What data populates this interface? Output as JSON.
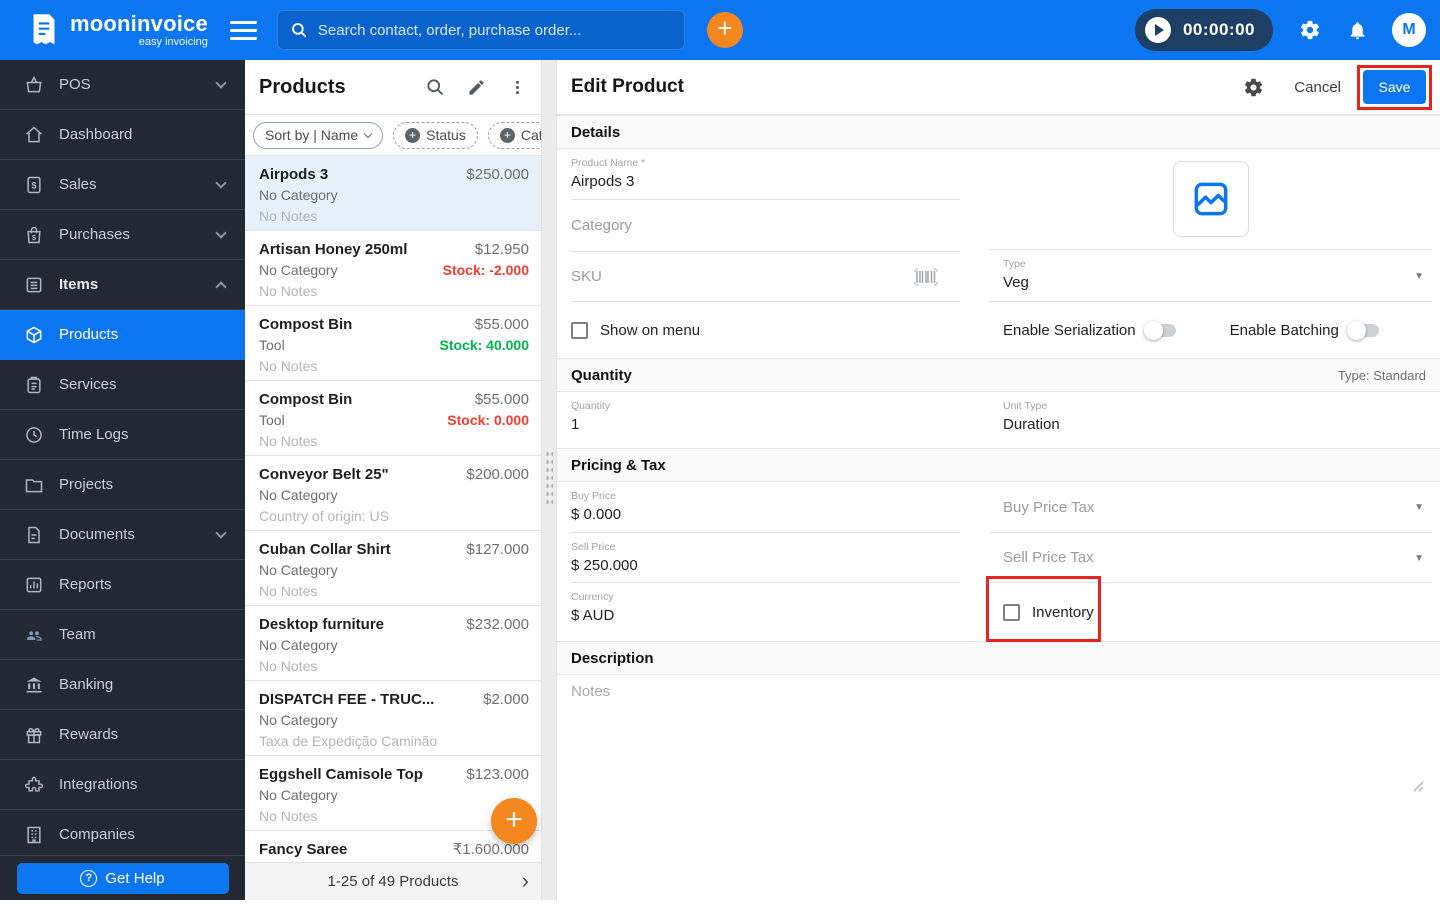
{
  "topbar": {
    "brand": "mooninvoice",
    "tagline": "easy invoicing",
    "search_placeholder": "Search contact, order, purchase order...",
    "timer": "00:00:00",
    "avatar_initial": "M"
  },
  "icons": {
    "add": "+",
    "pagination_next": "›"
  },
  "colors": {
    "accent": "#0b76f0",
    "orange": "#f5871f",
    "annotation_red": "#e8231f",
    "stock_negative": "#f43b30",
    "stock_positive": "#00b44e"
  },
  "sidebar": {
    "items": [
      {
        "label": "POS"
      },
      {
        "label": "Dashboard"
      },
      {
        "label": "Sales"
      },
      {
        "label": "Purchases"
      },
      {
        "label": "Items"
      },
      {
        "label": "Products"
      },
      {
        "label": "Services"
      },
      {
        "label": "Time Logs"
      },
      {
        "label": "Projects"
      },
      {
        "label": "Documents"
      },
      {
        "label": "Reports"
      },
      {
        "label": "Team"
      },
      {
        "label": "Banking"
      },
      {
        "label": "Rewards"
      },
      {
        "label": "Integrations"
      },
      {
        "label": "Companies"
      }
    ],
    "get_help": "Get Help"
  },
  "products_panel": {
    "title": "Products",
    "sort_chip": "Sort by | Name",
    "status_chip": "Status",
    "category_chip": "Category",
    "list": [
      {
        "name": "Airpods 3",
        "category": "No Category",
        "note": "No Notes",
        "price": "$250.000",
        "stock": ""
      },
      {
        "name": "Artisan Honey 250ml",
        "category": "No Category",
        "note": "No Notes",
        "price": "$12.950",
        "stock": "Stock: -2.000"
      },
      {
        "name": "Compost Bin",
        "category": "Tool",
        "note": "No Notes",
        "price": "$55.000",
        "stock": "Stock: 40.000"
      },
      {
        "name": "Compost Bin",
        "category": "Tool",
        "note": "No Notes",
        "price": "$55.000",
        "stock": "Stock: 0.000"
      },
      {
        "name": "Conveyor Belt 25\"",
        "category": "No Category",
        "note": "Country of origin: US",
        "price": "$200.000",
        "stock": ""
      },
      {
        "name": "Cuban Collar Shirt",
        "category": "No Category",
        "note": "No Notes",
        "price": "$127.000",
        "stock": ""
      },
      {
        "name": "Desktop furniture",
        "category": "No Category",
        "note": "No Notes",
        "price": "$232.000",
        "stock": ""
      },
      {
        "name": "DISPATCH FEE - TRUC...",
        "category": "No Category",
        "note": "Taxa de Expedição Caminão",
        "price": "$2.000",
        "stock": ""
      },
      {
        "name": "Eggshell Camisole Top",
        "category": "No Category",
        "note": "No Notes",
        "price": "$123.000",
        "stock": ""
      },
      {
        "name": "Fancy Saree",
        "category": "",
        "note": "",
        "price": "₹1.600.000",
        "stock": ""
      }
    ],
    "footer": "1-25 of 49 Products"
  },
  "edit_panel": {
    "title": "Edit Product",
    "cancel": "Cancel",
    "save": "Save",
    "sections": {
      "details": "Details",
      "quantity": "Quantity",
      "quantity_type": "Type: Standard",
      "pricing": "Pricing & Tax",
      "description": "Description"
    },
    "fields": {
      "product_name_label": "Product Name *",
      "product_name_value": "Airpods 3",
      "category_placeholder": "Category",
      "sku_placeholder": "SKU",
      "show_on_menu": "Show on menu",
      "type_label": "Type",
      "type_value": "Veg",
      "enable_serialization": "Enable Serialization",
      "enable_batching": "Enable Batching",
      "quantity_label": "Quantity",
      "quantity_value": "1",
      "unit_type_label": "Unit Type",
      "unit_type_value": "Duration",
      "buy_price_label": "Buy Price",
      "buy_price_value": "$ 0.000",
      "buy_price_tax": "Buy Price Tax",
      "sell_price_label": "Sell Price",
      "sell_price_value": "$ 250.000",
      "sell_price_tax": "Sell Price Tax",
      "currency_label": "Currency",
      "currency_value": "$ AUD",
      "inventory_label": "Inventory",
      "notes_placeholder": "Notes"
    }
  }
}
